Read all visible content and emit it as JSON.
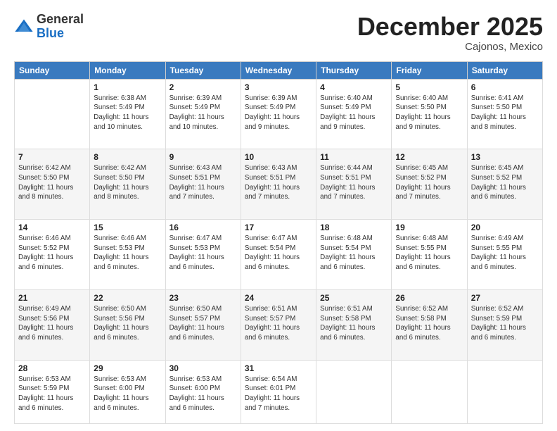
{
  "header": {
    "logo_line1": "General",
    "logo_line2": "Blue",
    "month": "December 2025",
    "location": "Cajonos, Mexico"
  },
  "weekdays": [
    "Sunday",
    "Monday",
    "Tuesday",
    "Wednesday",
    "Thursday",
    "Friday",
    "Saturday"
  ],
  "weeks": [
    [
      {
        "day": "",
        "info": ""
      },
      {
        "day": "1",
        "info": "Sunrise: 6:38 AM\nSunset: 5:49 PM\nDaylight: 11 hours and 10 minutes."
      },
      {
        "day": "2",
        "info": "Sunrise: 6:39 AM\nSunset: 5:49 PM\nDaylight: 11 hours and 10 minutes."
      },
      {
        "day": "3",
        "info": "Sunrise: 6:39 AM\nSunset: 5:49 PM\nDaylight: 11 hours and 9 minutes."
      },
      {
        "day": "4",
        "info": "Sunrise: 6:40 AM\nSunset: 5:49 PM\nDaylight: 11 hours and 9 minutes."
      },
      {
        "day": "5",
        "info": "Sunrise: 6:40 AM\nSunset: 5:50 PM\nDaylight: 11 hours and 9 minutes."
      },
      {
        "day": "6",
        "info": "Sunrise: 6:41 AM\nSunset: 5:50 PM\nDaylight: 11 hours and 8 minutes."
      }
    ],
    [
      {
        "day": "7",
        "info": "Sunrise: 6:42 AM\nSunset: 5:50 PM\nDaylight: 11 hours and 8 minutes."
      },
      {
        "day": "8",
        "info": "Sunrise: 6:42 AM\nSunset: 5:50 PM\nDaylight: 11 hours and 8 minutes."
      },
      {
        "day": "9",
        "info": "Sunrise: 6:43 AM\nSunset: 5:51 PM\nDaylight: 11 hours and 7 minutes."
      },
      {
        "day": "10",
        "info": "Sunrise: 6:43 AM\nSunset: 5:51 PM\nDaylight: 11 hours and 7 minutes."
      },
      {
        "day": "11",
        "info": "Sunrise: 6:44 AM\nSunset: 5:51 PM\nDaylight: 11 hours and 7 minutes."
      },
      {
        "day": "12",
        "info": "Sunrise: 6:45 AM\nSunset: 5:52 PM\nDaylight: 11 hours and 7 minutes."
      },
      {
        "day": "13",
        "info": "Sunrise: 6:45 AM\nSunset: 5:52 PM\nDaylight: 11 hours and 6 minutes."
      }
    ],
    [
      {
        "day": "14",
        "info": "Sunrise: 6:46 AM\nSunset: 5:52 PM\nDaylight: 11 hours and 6 minutes."
      },
      {
        "day": "15",
        "info": "Sunrise: 6:46 AM\nSunset: 5:53 PM\nDaylight: 11 hours and 6 minutes."
      },
      {
        "day": "16",
        "info": "Sunrise: 6:47 AM\nSunset: 5:53 PM\nDaylight: 11 hours and 6 minutes."
      },
      {
        "day": "17",
        "info": "Sunrise: 6:47 AM\nSunset: 5:54 PM\nDaylight: 11 hours and 6 minutes."
      },
      {
        "day": "18",
        "info": "Sunrise: 6:48 AM\nSunset: 5:54 PM\nDaylight: 11 hours and 6 minutes."
      },
      {
        "day": "19",
        "info": "Sunrise: 6:48 AM\nSunset: 5:55 PM\nDaylight: 11 hours and 6 minutes."
      },
      {
        "day": "20",
        "info": "Sunrise: 6:49 AM\nSunset: 5:55 PM\nDaylight: 11 hours and 6 minutes."
      }
    ],
    [
      {
        "day": "21",
        "info": "Sunrise: 6:49 AM\nSunset: 5:56 PM\nDaylight: 11 hours and 6 minutes."
      },
      {
        "day": "22",
        "info": "Sunrise: 6:50 AM\nSunset: 5:56 PM\nDaylight: 11 hours and 6 minutes."
      },
      {
        "day": "23",
        "info": "Sunrise: 6:50 AM\nSunset: 5:57 PM\nDaylight: 11 hours and 6 minutes."
      },
      {
        "day": "24",
        "info": "Sunrise: 6:51 AM\nSunset: 5:57 PM\nDaylight: 11 hours and 6 minutes."
      },
      {
        "day": "25",
        "info": "Sunrise: 6:51 AM\nSunset: 5:58 PM\nDaylight: 11 hours and 6 minutes."
      },
      {
        "day": "26",
        "info": "Sunrise: 6:52 AM\nSunset: 5:58 PM\nDaylight: 11 hours and 6 minutes."
      },
      {
        "day": "27",
        "info": "Sunrise: 6:52 AM\nSunset: 5:59 PM\nDaylight: 11 hours and 6 minutes."
      }
    ],
    [
      {
        "day": "28",
        "info": "Sunrise: 6:53 AM\nSunset: 5:59 PM\nDaylight: 11 hours and 6 minutes."
      },
      {
        "day": "29",
        "info": "Sunrise: 6:53 AM\nSunset: 6:00 PM\nDaylight: 11 hours and 6 minutes."
      },
      {
        "day": "30",
        "info": "Sunrise: 6:53 AM\nSunset: 6:00 PM\nDaylight: 11 hours and 6 minutes."
      },
      {
        "day": "31",
        "info": "Sunrise: 6:54 AM\nSunset: 6:01 PM\nDaylight: 11 hours and 7 minutes."
      },
      {
        "day": "",
        "info": ""
      },
      {
        "day": "",
        "info": ""
      },
      {
        "day": "",
        "info": ""
      }
    ]
  ]
}
